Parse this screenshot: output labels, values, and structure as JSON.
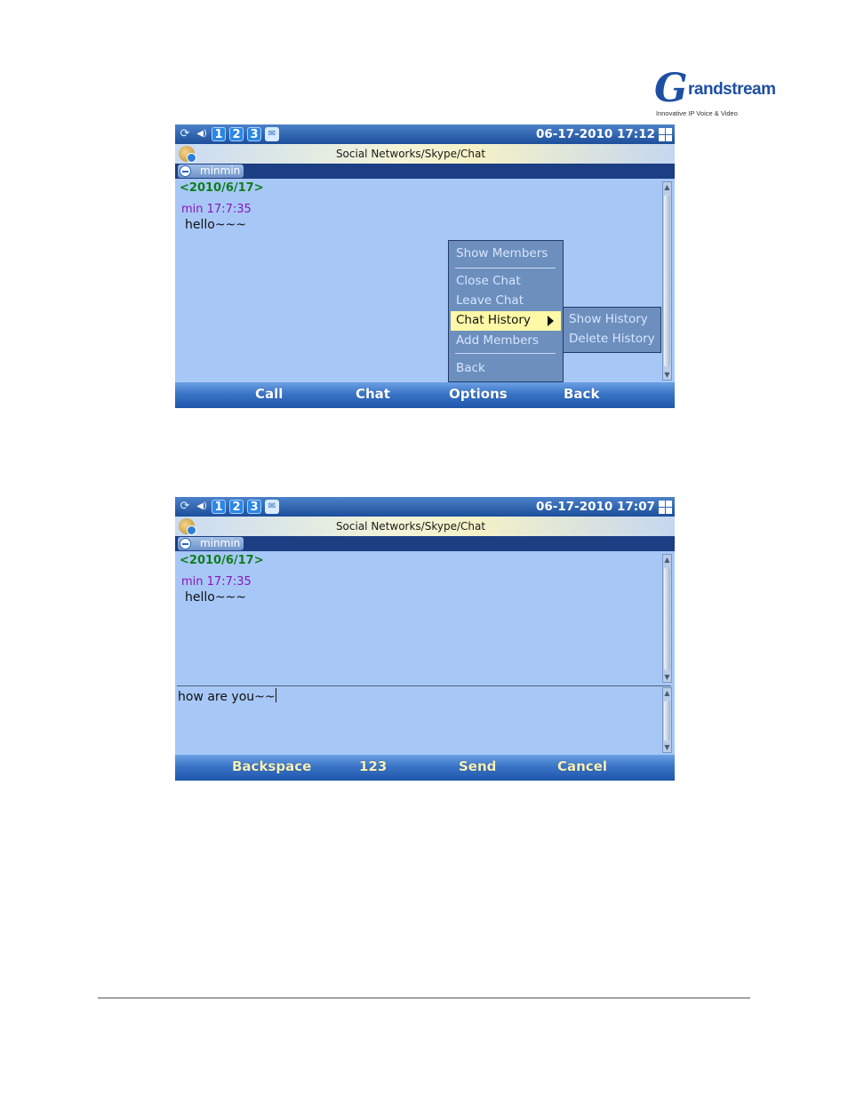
{
  "logo": {
    "brand_letter": "G",
    "brand_rest": "randstream",
    "tagline": "Innovative IP Voice & Video"
  },
  "screens": [
    {
      "status": {
        "lines": [
          "1",
          "2",
          "3"
        ],
        "datetime": "06-17-2010 17:12"
      },
      "title": "Social Networks/Skype/Chat",
      "contact_tab": "minmin",
      "chat": {
        "date": "<2010/6/17>",
        "sender": "min  17:7:35",
        "message": "hello~~~"
      },
      "menu": {
        "items": [
          "Show Members",
          "Close Chat",
          "Leave Chat",
          "Chat History",
          "Add Members",
          "Back"
        ],
        "highlighted": "Chat History",
        "submenu": [
          "Show History",
          "Delete History"
        ]
      },
      "softkeys": [
        "Call",
        "Chat",
        "Options",
        "Back"
      ]
    },
    {
      "status": {
        "lines": [
          "1",
          "2",
          "3"
        ],
        "datetime": "06-17-2010 17:07"
      },
      "title": "Social Networks/Skype/Chat",
      "contact_tab": "minmin",
      "chat": {
        "date": "<2010/6/17>",
        "sender": "min  17:7:35",
        "message": "hello~~~"
      },
      "input": {
        "value": "how are you~~"
      },
      "softkeys": [
        "Backspace",
        "123",
        "Send",
        "Cancel"
      ]
    }
  ],
  "colors": {
    "screen_bg": "#a7c8f7",
    "date_text": "#107d1c",
    "sender_text": "#8a16b8",
    "highlight": "#fff8a6"
  }
}
